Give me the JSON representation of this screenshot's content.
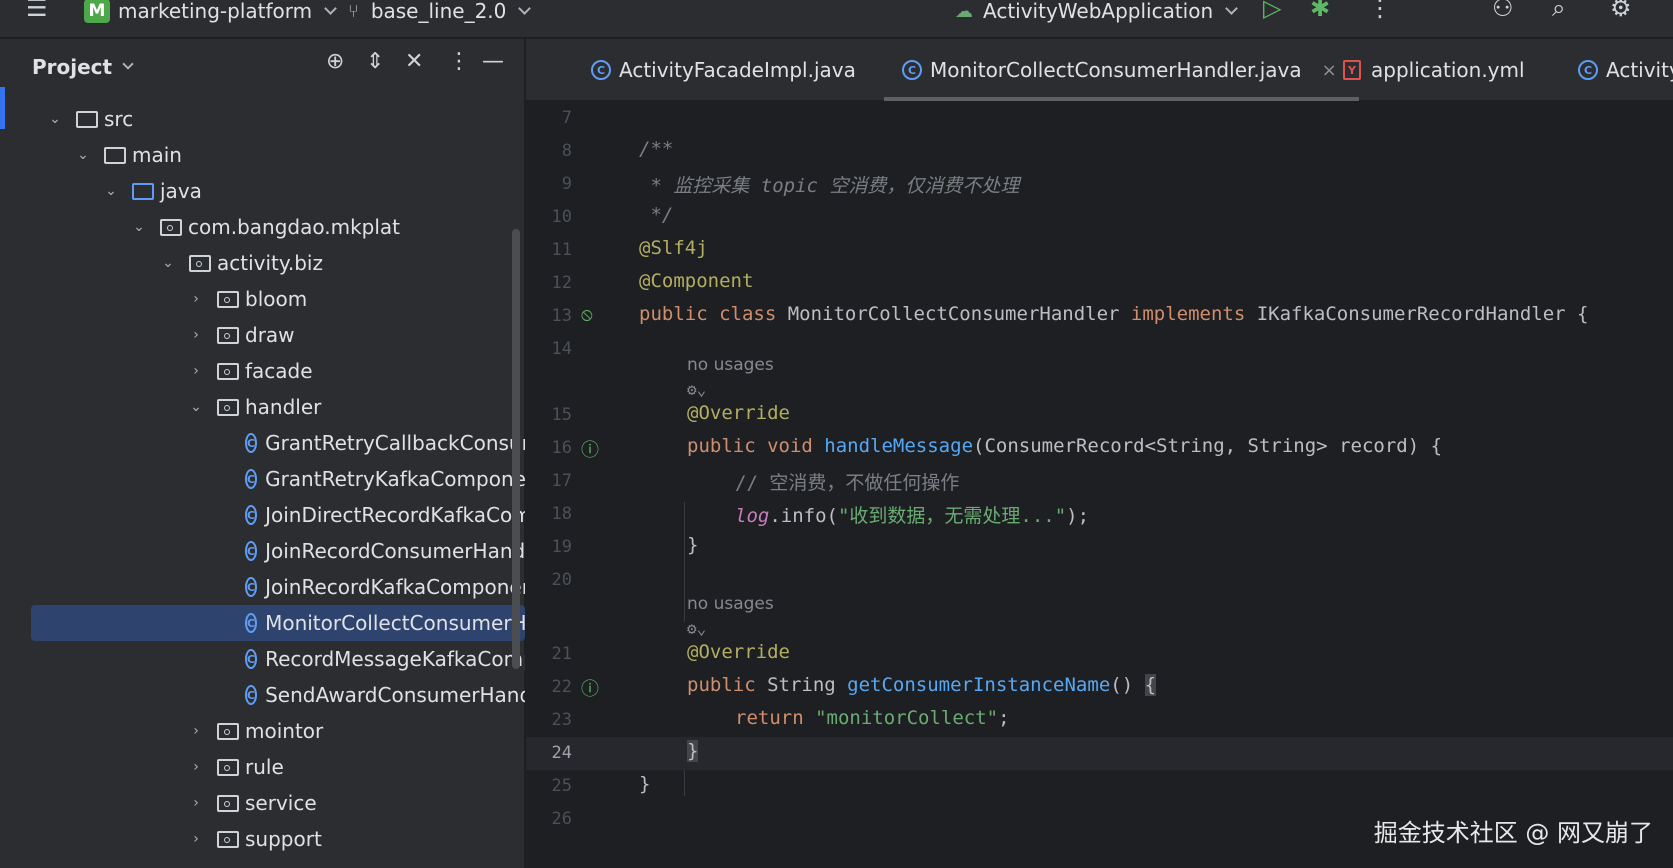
{
  "titlebar": {
    "project_badge": "M",
    "project_name": "marketing-platform",
    "branch": "base_line_2.0",
    "run_config": "ActivityWebApplication",
    "icons": [
      "menu-icon",
      "branch-icon",
      "run-config-icon",
      "run-icon",
      "debug-icon",
      "more-icon",
      "add-user-icon",
      "search-icon",
      "settings-icon"
    ]
  },
  "panel": {
    "title": "Project",
    "tree": [
      {
        "label": "src",
        "kind": "folder",
        "expanded": true
      },
      {
        "label": "main",
        "kind": "folder",
        "expanded": true
      },
      {
        "label": "java",
        "kind": "source-folder",
        "expanded": true
      },
      {
        "label": "com.bangdao.mkplat",
        "kind": "package",
        "expanded": true
      },
      {
        "label": "activity.biz",
        "kind": "package",
        "expanded": true
      },
      {
        "label": "bloom",
        "kind": "package",
        "expanded": false
      },
      {
        "label": "draw",
        "kind": "package",
        "expanded": false
      },
      {
        "label": "facade",
        "kind": "package",
        "expanded": false
      },
      {
        "label": "handler",
        "kind": "package",
        "expanded": true
      },
      {
        "label": "GrantRetryCallbackConsum",
        "kind": "class"
      },
      {
        "label": "GrantRetryKafkaComponen",
        "kind": "class"
      },
      {
        "label": "JoinDirectRecordKafkaCom",
        "kind": "class"
      },
      {
        "label": "JoinRecordConsumerHandl",
        "kind": "class"
      },
      {
        "label": "JoinRecordKafkaComponer",
        "kind": "class"
      },
      {
        "label": "MonitorCollectConsumerHa",
        "kind": "class",
        "selected": true
      },
      {
        "label": "RecordMessageKafkaComp",
        "kind": "class"
      },
      {
        "label": "SendAwardConsumerHandl",
        "kind": "class"
      },
      {
        "label": "mointor",
        "kind": "package",
        "expanded": false
      },
      {
        "label": "rule",
        "kind": "package",
        "expanded": false
      },
      {
        "label": "service",
        "kind": "package",
        "expanded": false
      },
      {
        "label": "support",
        "kind": "package",
        "expanded": false
      }
    ]
  },
  "tabs": [
    {
      "label": "ActivityFacadeImpl.java",
      "icon": "class-icon"
    },
    {
      "label": "MonitorCollectConsumerHandler.java",
      "icon": "class-icon",
      "active": true,
      "close": "×"
    },
    {
      "label": "application.yml",
      "icon": "yaml-icon"
    },
    {
      "label": "Activity",
      "icon": "class-icon"
    }
  ],
  "editor": {
    "line_numbers": [
      "7",
      "8",
      "9",
      "10",
      "11",
      "12",
      "13",
      "14",
      "15",
      "16",
      "17",
      "18",
      "19",
      "20",
      "21",
      "22",
      "23",
      "24",
      "25",
      "26"
    ],
    "current_line": "24",
    "code": {
      "l8": "/**",
      "l9_a": " * ",
      "l9_b": "监控采集",
      "l9_c": " topic ",
      "l9_d": "空消费，仅消费不处理",
      "l10": " */",
      "l11": "@Slf4j",
      "l12": "@Component",
      "l13_kw1": "public class",
      "l13_name": " MonitorCollectConsumerHandler ",
      "l13_kw2": "implements",
      "l13_rest": " IKafkaConsumerRecordHandler {",
      "hint_usages_1": "no usages",
      "l15": "@Override",
      "l16_kw": "public void",
      "l16_fn": "handleMessage",
      "l16_rest": "(ConsumerRecord<String, String> record) {",
      "l17": "// 空消费，不做任何操作",
      "l18_log": "log",
      "l18_mid": ".info(",
      "l18_str": "\"收到数据，无需处理...\"",
      "l18_end": ");",
      "l19": "}",
      "hint_usages_2": "no usages",
      "l21": "@Override",
      "l22_kw": "public",
      "l22_type": " String ",
      "l22_fn": "getConsumerInstanceName",
      "l22_paren": "() ",
      "l22_brace": "{",
      "l23_kw": "return",
      "l23_str": "\"monitorCollect\"",
      "l23_end": ";",
      "l24": "}",
      "l25": "}"
    }
  },
  "watermark": "掘金技术社区 @ 网又崩了",
  "colors": {
    "accent": "#3574f0",
    "selection": "#2e436e",
    "keyword": "#cf8e6d",
    "annotation": "#b3ae60",
    "function": "#56a8f5",
    "string": "#6aab73"
  }
}
